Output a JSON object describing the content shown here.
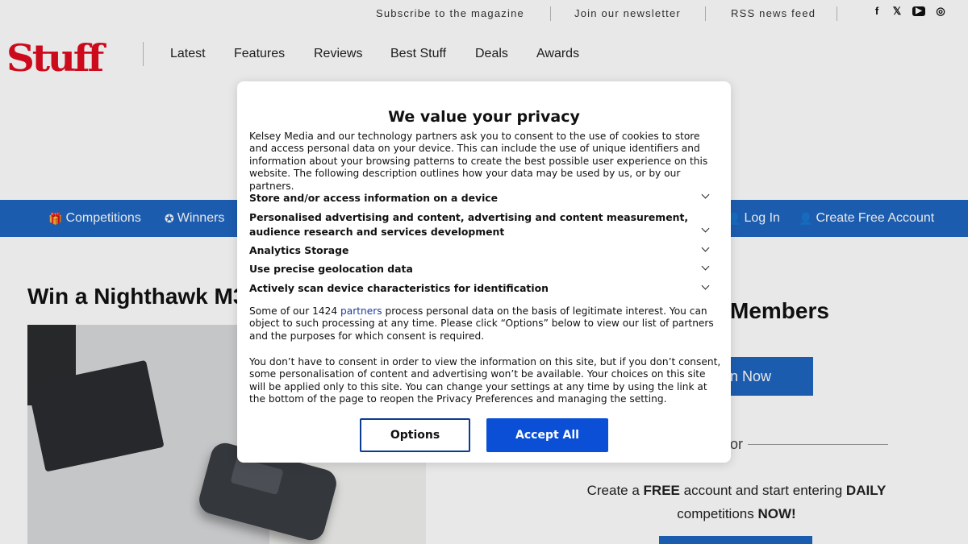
{
  "topbar": {
    "links": [
      "Subscribe to the magazine",
      "Join our newsletter",
      "RSS news feed"
    ],
    "social": [
      {
        "icon": "facebook-icon",
        "glyph": "f"
      },
      {
        "icon": "x-icon",
        "glyph": "𝕏"
      },
      {
        "icon": "youtube-icon",
        "glyph": "▶"
      },
      {
        "icon": "instagram-icon",
        "glyph": "◎"
      }
    ]
  },
  "header": {
    "logo": "Stuff",
    "nav": [
      "Latest",
      "Features",
      "Reviews",
      "Best Stuff",
      "Deals",
      "Awards"
    ]
  },
  "subnav": {
    "competitions": "Competitions",
    "winners": "Winners",
    "login": "Log In",
    "create_account": "Create Free Account"
  },
  "content": {
    "article_title": "Win a Nighthawk M3",
    "members_heading": "Members",
    "join_button": "n Now",
    "or_label": "or",
    "promo": {
      "part1": "Create a ",
      "free": "FREE",
      "part2": " account and start entering ",
      "daily": "DAILY",
      "part3": "competitions ",
      "now": "NOW!"
    }
  },
  "consent": {
    "title": "We value your privacy",
    "intro": "Kelsey Media and our technology partners ask you to consent to the use of cookies to store and access personal data on your device. This can include the use of unique identifiers and information about your browsing patterns to create the best possible user experience on this website. The following description outlines how your data may be used by us, or by our partners.",
    "purposes": [
      "Store and/or access information on a device",
      "Personalised advertising and content, advertising and content measurement, audience research and services development",
      "Analytics Storage",
      "Use precise geolocation data",
      "Actively scan device characteristics for identification"
    ],
    "legit_prefix": "Some of our 1424 ",
    "legit_link": "partners",
    "legit_suffix": " process personal data on the basis of legitimate interest. You can object to such processing at any time. Please click “Options” below to view our list of partners and the purposes for which consent is required.",
    "no_consent": "You don’t have to consent in order to view the information on this site, but if you don’t consent, some personalisation of content and advertising won’t be available. Your choices on this site will be applied only to this site. You can change your settings at any time by using the link at the bottom of the page to reopen the Privacy Preferences and managing the setting.",
    "options_button": "Options",
    "accept_button": "Accept All"
  },
  "colors": {
    "brand_red": "#e10b1f",
    "nav_blue": "#1f66c1",
    "accept_blue": "#0a4fd6",
    "options_border": "#0a3c8f"
  }
}
